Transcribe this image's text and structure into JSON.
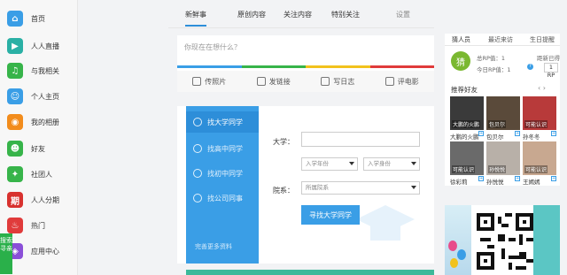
{
  "sidebar": {
    "items": [
      {
        "label": "首页",
        "icon": "home-icon",
        "color": "#3a9ee6",
        "glyph": "⌂"
      },
      {
        "label": "人人直播",
        "icon": "live-icon",
        "color": "#2ab0a5",
        "glyph": "▶"
      },
      {
        "label": "与我相关",
        "icon": "related-icon",
        "color": "#37b44a",
        "glyph": "♫"
      },
      {
        "label": "个人主页",
        "icon": "profile-icon",
        "color": "#3a9ee6",
        "glyph": "☺"
      },
      {
        "label": "我的相册",
        "icon": "album-icon",
        "color": "#f28c1c",
        "glyph": "◉"
      },
      {
        "label": "好友",
        "icon": "friends-icon",
        "color": "#37b44a",
        "glyph": "☻"
      },
      {
        "label": "社团人",
        "icon": "club-icon",
        "color": "#37b44a",
        "glyph": "✦"
      },
      {
        "label": "人人分期",
        "icon": "installment-icon",
        "color": "#d8322f",
        "glyph": "期"
      },
      {
        "label": "热门",
        "icon": "hot-icon",
        "color": "#e03b3b",
        "glyph": "♨"
      },
      {
        "label": "应用中心",
        "icon": "apps-icon",
        "color": "#8a4fd8",
        "glyph": "◈"
      }
    ],
    "search_tab": "搜索寻亲"
  },
  "topnav": {
    "tabs": [
      "新鲜事",
      "原创内容",
      "关注内容",
      "特别关注"
    ],
    "settings": "设置"
  },
  "composer": {
    "placeholder": "你现在在想什么？",
    "actions": [
      "传照片",
      "发链接",
      "写日志",
      "评电影"
    ]
  },
  "finder": {
    "nav": [
      "找大学同学",
      "找高中同学",
      "找初中同学",
      "找公司同事"
    ],
    "more": "完善更多资料",
    "university_label": "大学：",
    "year_placeholder": "入学年份",
    "identity_placeholder": "入学身份",
    "dept_label": "院系：",
    "dept_placeholder": "所属院系",
    "button": "寻找大学同学"
  },
  "right_panel": {
    "tabs": [
      "猜人员",
      "最近来访",
      "生日提醒"
    ],
    "badge": "猜",
    "total_rp": "总RP值：1",
    "today_rp": "今日RP值：1",
    "rank_label": "距新已得",
    "rank_value": "1 RP",
    "rec_title": "推荐好友",
    "friends": [
      {
        "name": "大鹏的火鹏",
        "tag": "大鹏的火鹏",
        "bg": "#3a3a3a"
      },
      {
        "name": "包贝尔",
        "tag": "包贝尔",
        "bg": "#5a4a3a"
      },
      {
        "name": "孙冬冬",
        "tag": "可能认识",
        "bg": "#b83a3a"
      },
      {
        "name": "徐彩莉",
        "tag": "可能认识",
        "bg": "#6a6a6a"
      },
      {
        "name": "孙悦悦",
        "tag": "孙悦悦",
        "bg": "#b8b0a8"
      },
      {
        "name": "王嫣嫣",
        "tag": "可能认识",
        "bg": "#c8a890"
      }
    ]
  }
}
